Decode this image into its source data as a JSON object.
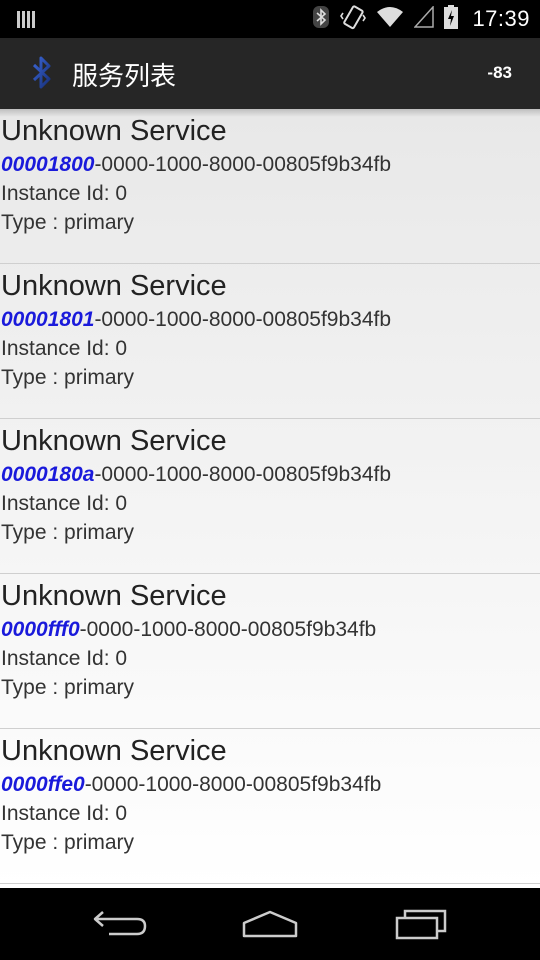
{
  "status_bar": {
    "time": "17:39"
  },
  "action_bar": {
    "title": "服务列表",
    "rssi": "-83"
  },
  "services": [
    {
      "name": "Unknown Service",
      "uuid_short": "00001800",
      "uuid_rest": "-0000-1000-8000-00805f9b34fb",
      "instance": "Instance Id: 0",
      "type": "Type : primary"
    },
    {
      "name": "Unknown Service",
      "uuid_short": "00001801",
      "uuid_rest": "-0000-1000-8000-00805f9b34fb",
      "instance": "Instance Id: 0",
      "type": "Type : primary"
    },
    {
      "name": "Unknown Service",
      "uuid_short": "0000180a",
      "uuid_rest": "-0000-1000-8000-00805f9b34fb",
      "instance": "Instance Id: 0",
      "type": "Type : primary"
    },
    {
      "name": "Unknown Service",
      "uuid_short": "0000fff0",
      "uuid_rest": "-0000-1000-8000-00805f9b34fb",
      "instance": "Instance Id: 0",
      "type": "Type : primary"
    },
    {
      "name": "Unknown Service",
      "uuid_short": "0000ffe0",
      "uuid_rest": "-0000-1000-8000-00805f9b34fb",
      "instance": "Instance Id: 0",
      "type": "Type : primary"
    }
  ],
  "colors": {
    "uuid_accent": "#1a1adb",
    "action_bar_bg": "#262626"
  },
  "icons": {
    "status_left": "signal-bars-icon",
    "bluetooth": "bluetooth-icon",
    "vibrate": "vibrate-icon",
    "wifi": "wifi-icon",
    "cell": "cell-signal-icon",
    "battery": "battery-icon",
    "back": "back-icon",
    "home": "home-icon",
    "recents": "recents-icon"
  }
}
